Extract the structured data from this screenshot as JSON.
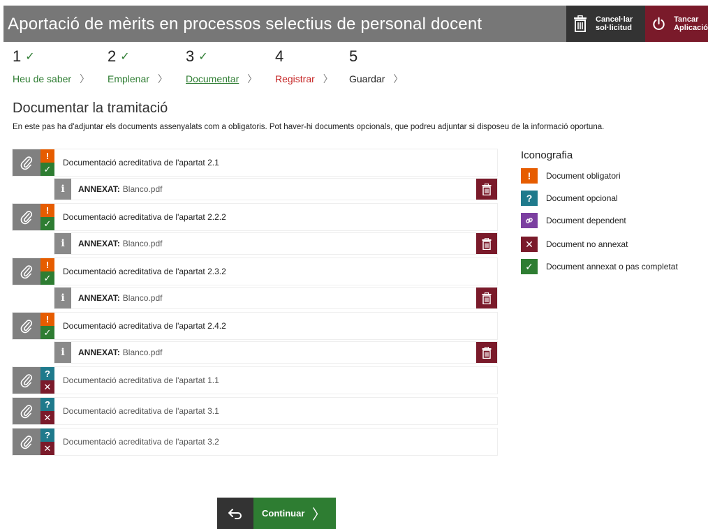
{
  "header": {
    "title": "Aportació de mèrits en processos selectius de personal docent",
    "cancel_label": "Cancel·lar sol·licitud",
    "close_label": "Tancar Aplicació"
  },
  "steps": [
    {
      "number": "1",
      "check": "✓",
      "label": "Heu de saber"
    },
    {
      "number": "2",
      "check": "✓",
      "label": "Emplenar"
    },
    {
      "number": "3",
      "check": "✓",
      "label": "Documentar"
    },
    {
      "number": "4",
      "check": "",
      "label": "Registrar"
    },
    {
      "number": "5",
      "check": "",
      "label": "Guardar"
    }
  ],
  "section": {
    "title": "Documentar la tramitació",
    "intro": "En este pas ha d'adjuntar els documents assenyalats com a obligatoris. Pot haver-hi documents opcionals, que podreu adjuntar si disposeu de la informació oportuna."
  },
  "documents": [
    {
      "title": "Documentació acreditativa de l'apartat 2.1",
      "annex_key": "ANNEXAT:",
      "annex_file": "Blanco.pdf"
    },
    {
      "title": "Documentació acreditativa de l'apartat 2.2.2",
      "annex_key": "ANNEXAT:",
      "annex_file": "Blanco.pdf"
    },
    {
      "title": "Documentació acreditativa de l'apartat 2.3.2",
      "annex_key": "ANNEXAT:",
      "annex_file": "Blanco.pdf"
    },
    {
      "title": "Documentació acreditativa de l'apartat 2.4.2",
      "annex_key": "ANNEXAT:",
      "annex_file": "Blanco.pdf"
    },
    {
      "title": "Documentació acreditativa de l'apartat 1.1"
    },
    {
      "title": "Documentació acreditativa de l'apartat 3.1"
    },
    {
      "title": "Documentació acreditativa de l'apartat 3.2"
    }
  ],
  "legend": {
    "title": "Iconografia",
    "items": [
      {
        "label": "Document obligatori"
      },
      {
        "label": "Document opcional"
      },
      {
        "label": "Document dependent"
      },
      {
        "label": "Document no annexat"
      },
      {
        "label": "Document annexat o pas completat"
      }
    ]
  },
  "continue": {
    "label": "Continuar"
  },
  "colors": {
    "header_bg": "#777777",
    "cancel_bg": "#333333",
    "close_bg": "#7a1a2a",
    "obligatori": "#e65c00",
    "opcional": "#1f7a8c",
    "dependent": "#7b3fa0",
    "ok": "#2e7d32",
    "no": "#7a1a2a"
  }
}
